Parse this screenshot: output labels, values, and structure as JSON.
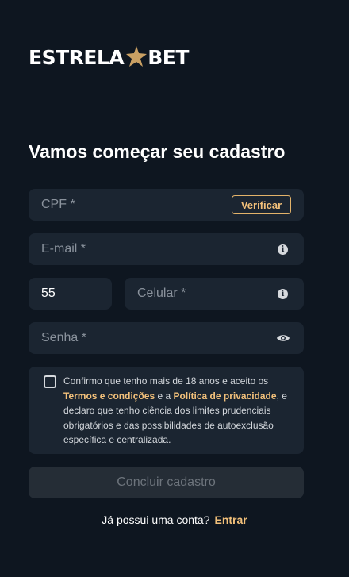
{
  "brand": {
    "word1": "ESTRELA",
    "word2": "BET",
    "star_color": "#c9a063"
  },
  "form": {
    "title": "Vamos começar seu cadastro",
    "cpf": {
      "placeholder": "CPF *",
      "verify_label": "Verificar"
    },
    "email": {
      "placeholder": "E-mail *",
      "icon": "info-icon"
    },
    "country_code": {
      "value": "55"
    },
    "phone": {
      "placeholder": "Celular *",
      "icon": "info-icon"
    },
    "password": {
      "placeholder": "Senha *",
      "icon": "eye-icon"
    },
    "consent": {
      "checked": false,
      "text1": "Confirmo que tenho mais de 18 anos e aceito os",
      "terms_link": "Termos e condições",
      "text2": " e a ",
      "privacy_link": "Política de privacidade",
      "text3": ", e declaro que tenho ciência dos limites prudenciais obrigatórios e das possibilidades de autoexclusão específica e centralizada."
    },
    "submit_label": "Concluir cadastro",
    "login_prompt": "Já possui uma conta?",
    "login_link": "Entrar"
  },
  "colors": {
    "background": "#0e1620",
    "field": "#1b2531",
    "accent": "#f2c07a"
  }
}
